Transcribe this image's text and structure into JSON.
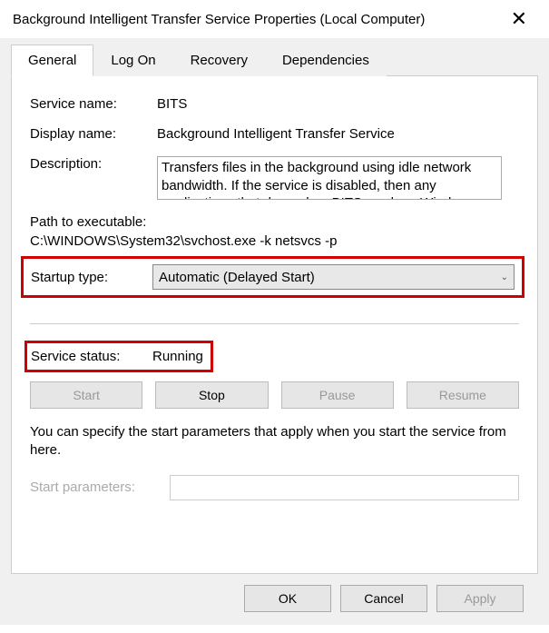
{
  "titlebar": {
    "title": "Background Intelligent Transfer Service Properties (Local Computer)"
  },
  "tabs": {
    "items": [
      {
        "label": "General",
        "active": true
      },
      {
        "label": "Log On",
        "active": false
      },
      {
        "label": "Recovery",
        "active": false
      },
      {
        "label": "Dependencies",
        "active": false
      }
    ]
  },
  "general": {
    "service_name_label": "Service name:",
    "service_name_value": "BITS",
    "display_name_label": "Display name:",
    "display_name_value": "Background Intelligent Transfer Service",
    "description_label": "Description:",
    "description_value": "Transfers files in the background using idle network bandwidth. If the service is disabled, then any applications that depend on BITS, such as Windows",
    "path_label": "Path to executable:",
    "path_value": "C:\\WINDOWS\\System32\\svchost.exe -k netsvcs -p",
    "startup_type_label": "Startup type:",
    "startup_type_value": "Automatic (Delayed Start)",
    "service_status_label": "Service status:",
    "service_status_value": "Running",
    "buttons": {
      "start": "Start",
      "stop": "Stop",
      "pause": "Pause",
      "resume": "Resume"
    },
    "help_text": "You can specify the start parameters that apply when you start the service from here.",
    "start_params_label": "Start parameters:",
    "start_params_value": ""
  },
  "footer": {
    "ok": "OK",
    "cancel": "Cancel",
    "apply": "Apply"
  }
}
